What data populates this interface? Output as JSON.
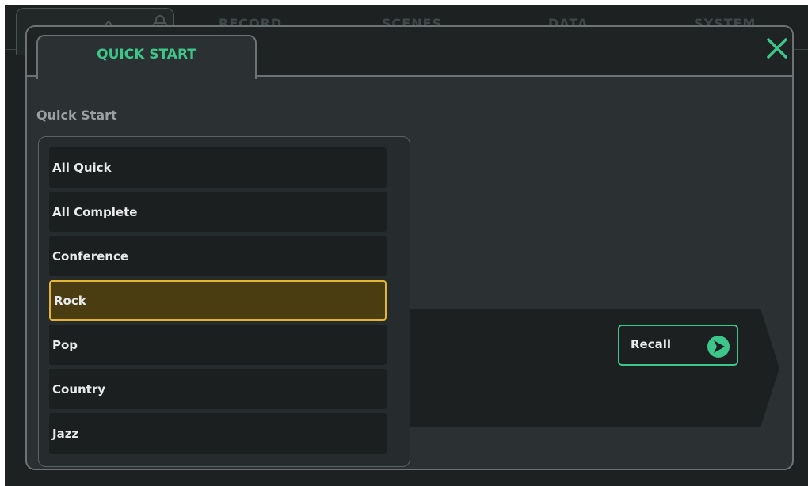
{
  "background_nav": {
    "tabs": [
      "RECORD",
      "SCENES",
      "DATA",
      "SYSTEM"
    ]
  },
  "dialog": {
    "tab_label": "QUICK START",
    "section_title": "Quick Start",
    "items": [
      {
        "label": "All Quick",
        "selected": false
      },
      {
        "label": "All Complete",
        "selected": false
      },
      {
        "label": "Conference",
        "selected": false
      },
      {
        "label": "Rock",
        "selected": true
      },
      {
        "label": "Pop",
        "selected": false
      },
      {
        "label": "Country",
        "selected": false
      },
      {
        "label": "Jazz",
        "selected": false
      }
    ],
    "recall_label": "Recall"
  },
  "icons": {
    "close": "close-icon",
    "recall": "recall-arrow-icon",
    "home": "home-icon",
    "lock": "lock-icon"
  },
  "colors": {
    "accent_green": "#3ec58a",
    "selected_border": "#e6b433",
    "selected_fill": "#4b3d12"
  }
}
